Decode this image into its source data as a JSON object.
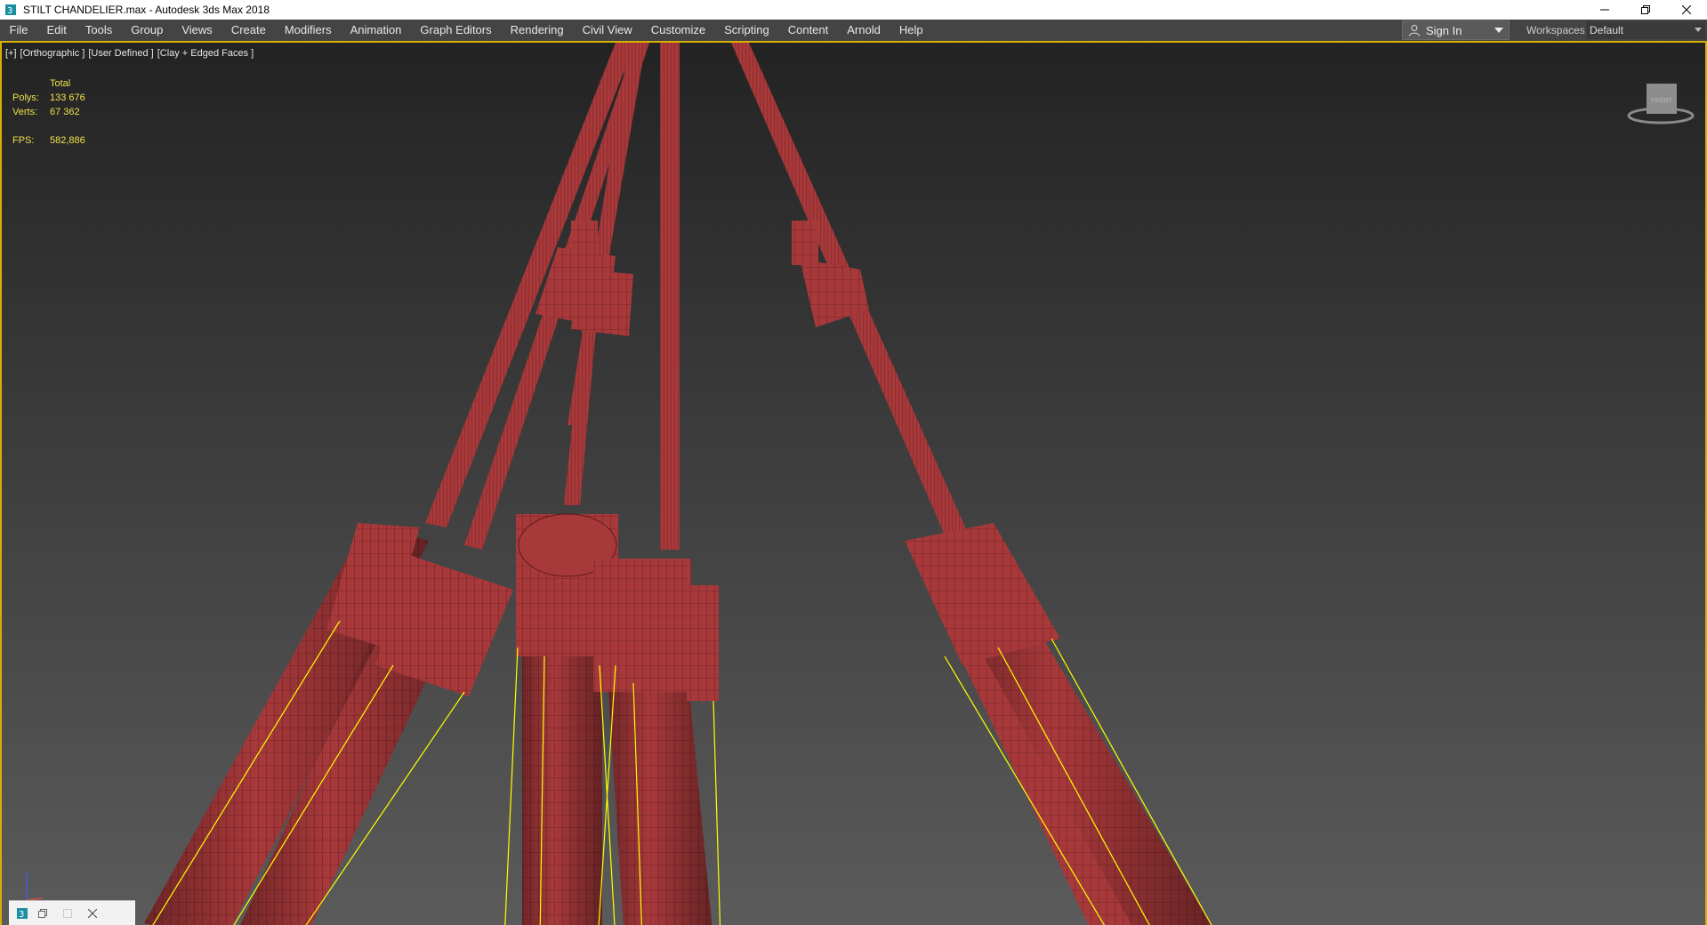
{
  "window": {
    "title": "STILT CHANDELIER.max - Autodesk 3ds Max 2018",
    "app_icon": "3ds-max-icon",
    "controls": [
      "minimize-icon",
      "restore-icon",
      "close-icon"
    ]
  },
  "menubar": {
    "items": [
      {
        "label": "File"
      },
      {
        "label": "Edit"
      },
      {
        "label": "Tools"
      },
      {
        "label": "Group"
      },
      {
        "label": "Views"
      },
      {
        "label": "Create"
      },
      {
        "label": "Modifiers"
      },
      {
        "label": "Animation"
      },
      {
        "label": "Graph Editors"
      },
      {
        "label": "Rendering"
      },
      {
        "label": "Civil View"
      },
      {
        "label": "Customize"
      },
      {
        "label": "Scripting"
      },
      {
        "label": "Content"
      },
      {
        "label": "Arnold"
      },
      {
        "label": "Help"
      }
    ],
    "signin": {
      "label": "Sign In",
      "icon": "user-icon"
    },
    "workspaces": {
      "label": "Workspaces:",
      "value": "Default"
    }
  },
  "viewport": {
    "label_plus": "[+]",
    "label_view": "[Orthographic ]",
    "label_mode": "[User Defined ]",
    "label_shading": "[Clay + Edged Faces ]",
    "stats": {
      "header": "Total",
      "polys_label": "Polys:",
      "polys_value": "133 676",
      "verts_label": "Verts:",
      "verts_value": "67 362",
      "fps_label": "FPS:",
      "fps_value": "582,886"
    },
    "viewcube_face": "FRONT"
  },
  "colors": {
    "accent_border": "#d6b000",
    "stats_text": "#f0e04a",
    "mesh": "#a8393b",
    "mesh_wire": "#5a1a1c",
    "selection": "#ffff00"
  }
}
